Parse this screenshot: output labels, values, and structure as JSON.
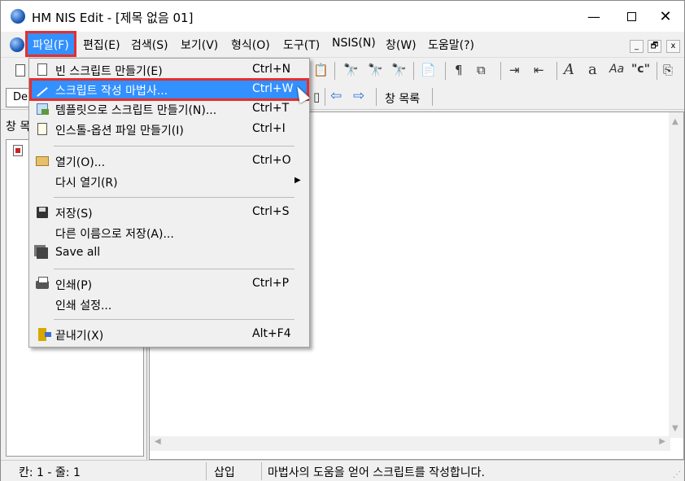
{
  "window": {
    "title": "HM NIS Edit - [제목 없음 01]",
    "controls": {
      "minimize": "—",
      "maximize": "",
      "close": "✕"
    }
  },
  "menubar": {
    "items": [
      {
        "label": "파일(F)",
        "active": true
      },
      {
        "label": "편집(E)"
      },
      {
        "label": "검색(S)"
      },
      {
        "label": "보기(V)"
      },
      {
        "label": "형식(O)"
      },
      {
        "label": "도구(T)"
      },
      {
        "label": "NSIS(N)"
      },
      {
        "label": "창(W)"
      },
      {
        "label": "도움말(?)"
      }
    ],
    "mdi_controls": [
      "_",
      "🗗",
      "x"
    ]
  },
  "toolbar2": {
    "combo_text": "De",
    "window_list_label": "창 목록"
  },
  "left_panel": {
    "title": "창 목"
  },
  "file_menu": {
    "items": [
      {
        "icon": "new-document-icon",
        "label": "빈 스크립트 만들기(E)",
        "shortcut": "Ctrl+N"
      },
      {
        "icon": "magic-wand-icon",
        "label": "스크립트 작성 마법사...",
        "shortcut": "Ctrl+W",
        "highlighted": true
      },
      {
        "icon": "template-icon",
        "label": "템플릿으로 스크립트 만들기(N)...",
        "shortcut": "Ctrl+T"
      },
      {
        "icon": "ini-file-icon",
        "label": "인스톨-옵션 파일 만들기(I)",
        "shortcut": "Ctrl+I"
      },
      {
        "icon": "open-folder-icon",
        "label": "열기(O)...",
        "shortcut": "Ctrl+O"
      },
      {
        "icon": "",
        "label": "다시 열기(R)",
        "shortcut": "",
        "submenu": true
      },
      {
        "icon": "save-disk-icon",
        "label": "저장(S)",
        "shortcut": "Ctrl+S"
      },
      {
        "icon": "",
        "label": "다른 이름으로 저장(A)...",
        "shortcut": ""
      },
      {
        "icon": "save-all-icon",
        "label": "Save all",
        "shortcut": ""
      },
      {
        "icon": "printer-icon",
        "label": "인쇄(P)",
        "shortcut": "Ctrl+P"
      },
      {
        "icon": "",
        "label": "인쇄 설정...",
        "shortcut": ""
      },
      {
        "icon": "exit-door-icon",
        "label": "끝내기(X)",
        "shortcut": "Alt+F4"
      }
    ]
  },
  "statusbar": {
    "position": "칸: 1 - 줄: 1",
    "mode": "삽입",
    "message": "마법사의 도움을 얻어 스크립트를 작성합니다."
  }
}
